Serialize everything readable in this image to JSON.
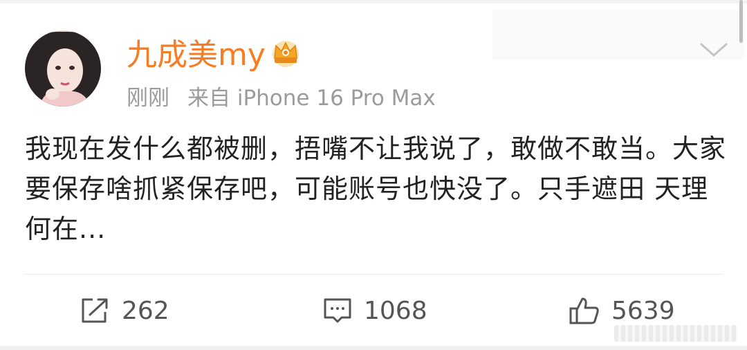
{
  "user": {
    "name": "九成美my",
    "badge_icon": "crown-badge-icon",
    "avatar_icon": "avatar-image"
  },
  "meta": {
    "time": "刚刚",
    "source": "来自 iPhone 16 Pro Max"
  },
  "post": {
    "text": "我现在发什么都被删，捂嘴不让我说了，敢做不敢当。大家要保存啥抓紧保存吧，可能账号也快没了。只手遮田 天理何在..."
  },
  "actions": {
    "repost_count": "262",
    "comment_count": "1068",
    "like_count": "5639"
  },
  "colors": {
    "username": "#f77c24",
    "meta": "#9b9b9b",
    "text": "#222222",
    "action": "#555555"
  }
}
